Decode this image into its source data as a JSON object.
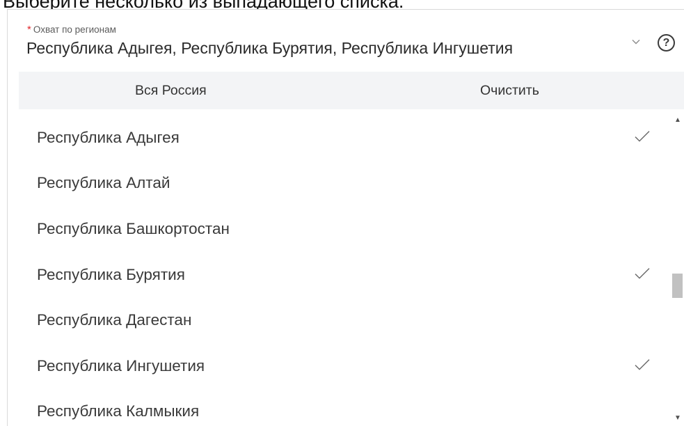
{
  "instruction": "Выберите несколько из выпадающего списка.",
  "field": {
    "required_mark": "*",
    "label": "Охват по регионам",
    "value": "Республика Адыгея, Республика Бурятия, Республика Ингушетия",
    "chevron_icon": "chevron-down-icon",
    "help_icon": "question-circle-icon",
    "help_glyph": "?"
  },
  "actions": {
    "select_all": "Вся Россия",
    "clear": "Очистить"
  },
  "items": [
    {
      "label": "Республика Адыгея",
      "selected": true
    },
    {
      "label": "Республика Алтай",
      "selected": false
    },
    {
      "label": "Республика Башкортостан",
      "selected": false
    },
    {
      "label": "Республика Бурятия",
      "selected": true
    },
    {
      "label": "Республика Дагестан",
      "selected": false
    },
    {
      "label": "Республика Ингушетия",
      "selected": true
    },
    {
      "label": "Республика Калмыкия",
      "selected": false
    }
  ],
  "scrollbar": {
    "position": 0.5
  },
  "colors": {
    "required": "#e0282e",
    "action_bar_bg": "#f3f4f6",
    "border": "#d9d9d9"
  }
}
